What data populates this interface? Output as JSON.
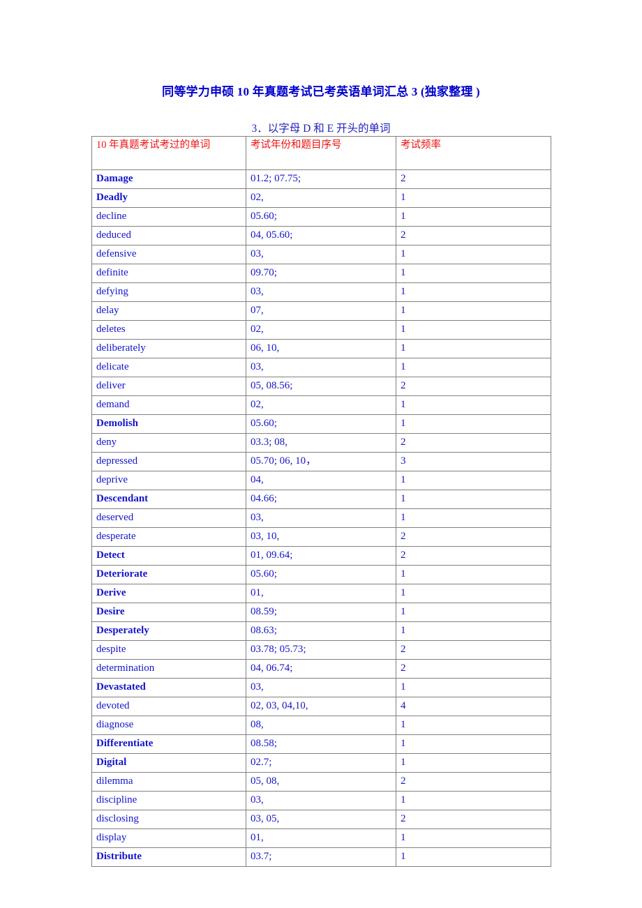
{
  "document": {
    "title": "同等学力申硕 10 年真题考试已考英语单词汇总  3 (独家整理  )",
    "section_heading": "3．以字母  D 和 E  开头的单词"
  },
  "table": {
    "headers": [
      "10 年真题考试考过的单词",
      "考试年份和题目序号",
      "考试频率"
    ],
    "rows": [
      {
        "word": "Damage",
        "bold": true,
        "years": "01.2; 07.75;",
        "freq": "2"
      },
      {
        "word": "Deadly",
        "bold": true,
        "years": "02,",
        "freq": "1"
      },
      {
        "word": "decline",
        "bold": false,
        "years": "05.60;",
        "freq": "1"
      },
      {
        "word": "deduced",
        "bold": false,
        "years": "04, 05.60;",
        "freq": "2"
      },
      {
        "word": "defensive",
        "bold": false,
        "years": "03,",
        "freq": "1"
      },
      {
        "word": "definite",
        "bold": false,
        "years": "09.70;",
        "freq": "1"
      },
      {
        "word": "defying",
        "bold": false,
        "years": "03,",
        "freq": "1"
      },
      {
        "word": "delay",
        "bold": false,
        "years": "07,",
        "freq": "1"
      },
      {
        "word": "deletes",
        "bold": false,
        "years": "02,",
        "freq": "1"
      },
      {
        "word": "deliberately",
        "bold": false,
        "years": "06, 10,",
        "freq": "1"
      },
      {
        "word": "delicate",
        "bold": false,
        "years": "03,",
        "freq": "1"
      },
      {
        "word": "deliver",
        "bold": false,
        "years": "05, 08.56;",
        "freq": "2"
      },
      {
        "word": "demand",
        "bold": false,
        "years": "02,",
        "freq": "1"
      },
      {
        "word": "Demolish",
        "bold": true,
        "years": "05.60;",
        "freq": "1"
      },
      {
        "word": "deny",
        "bold": false,
        "years": "03.3; 08,",
        "freq": "2"
      },
      {
        "word": "depressed",
        "bold": false,
        "years": "05.70; 06, 10，",
        "freq": "3"
      },
      {
        "word": "deprive",
        "bold": false,
        "years": "04,",
        "freq": "1"
      },
      {
        "word": "Descendant",
        "bold": true,
        "years": "04.66;",
        "freq": "1"
      },
      {
        "word": "deserved",
        "bold": false,
        "years": "03,",
        "freq": "1"
      },
      {
        "word": "desperate",
        "bold": false,
        "years": "03, 10,",
        "freq": "2"
      },
      {
        "word": "Detect",
        "bold": true,
        "years": "01, 09.64;",
        "freq": "2"
      },
      {
        "word": "Deteriorate",
        "bold": true,
        "years": "05.60;",
        "freq": "1"
      },
      {
        "word": "Derive",
        "bold": true,
        "years": "01,",
        "freq": "1"
      },
      {
        "word": "Desire",
        "bold": true,
        "years": "08.59;",
        "freq": "1"
      },
      {
        "word": "Desperately",
        "bold": true,
        "years": "08.63;",
        "freq": "1"
      },
      {
        "word": "despite",
        "bold": false,
        "years": "03.78; 05.73;",
        "freq": "2"
      },
      {
        "word": "determination",
        "bold": false,
        "years": "04, 06.74;",
        "freq": "2"
      },
      {
        "word": "Devastated",
        "bold": true,
        "years": "03,",
        "freq": "1"
      },
      {
        "word": "devoted",
        "bold": false,
        "years": "02, 03, 04,10,",
        "freq": "4"
      },
      {
        "word": "diagnose",
        "bold": false,
        "years": "08,",
        "freq": "1"
      },
      {
        "word": "Differentiate",
        "bold": true,
        "years": "08.58;",
        "freq": "1"
      },
      {
        "word": "Digital",
        "bold": true,
        "years": "02.7;",
        "freq": "1"
      },
      {
        "word": "dilemma",
        "bold": false,
        "years": "05, 08,",
        "freq": "2"
      },
      {
        "word": "discipline",
        "bold": false,
        "years": "03,",
        "freq": "1"
      },
      {
        "word": "disclosing",
        "bold": false,
        "years": "03, 05,",
        "freq": "2"
      },
      {
        "word": "display",
        "bold": false,
        "years": "01,",
        "freq": "1"
      },
      {
        "word": "Distribute",
        "bold": true,
        "years": "03.7;",
        "freq": "1"
      }
    ]
  },
  "colors": {
    "title_blue": "#0000cc",
    "heading_blue": "#2222bb",
    "header_red": "#ee1111",
    "cell_blue": "#1414cc",
    "border_gray": "#808080"
  }
}
